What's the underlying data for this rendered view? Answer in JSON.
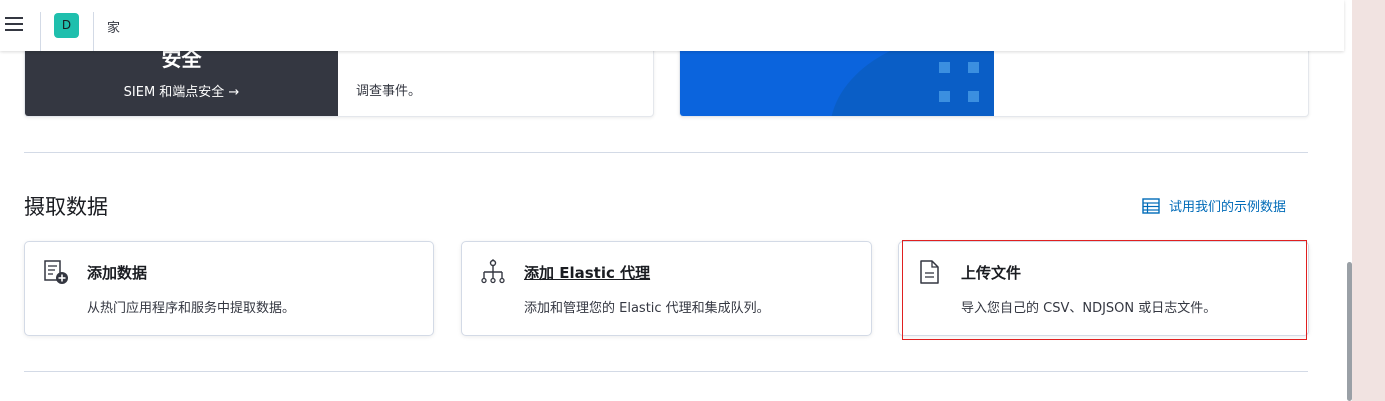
{
  "header": {
    "avatar_letter": "D",
    "breadcrumb": "家"
  },
  "top_cards": {
    "security": {
      "title": "安全",
      "link": "SIEM 和端点安全 →",
      "description": "调查事件。"
    }
  },
  "ingest": {
    "title": "摄取数据",
    "sample_link": "试用我们的示例数据",
    "cards": [
      {
        "icon": "add-data-icon",
        "title": "添加数据",
        "description": "从热门应用程序和服务中提取数据。"
      },
      {
        "icon": "agent-icon",
        "title": "添加 Elastic 代理",
        "description": "添加和管理您的 Elastic 代理和集成队列。"
      },
      {
        "icon": "document-icon",
        "title": "上传文件",
        "description": "导入您自己的 CSV、NDJSON 或日志文件。"
      }
    ]
  },
  "colors": {
    "accent": "#006bb8",
    "dark_panel": "#343741",
    "blue_panel": "#0b64dd",
    "highlight": "#e02020",
    "avatar": "#1fbfad"
  }
}
